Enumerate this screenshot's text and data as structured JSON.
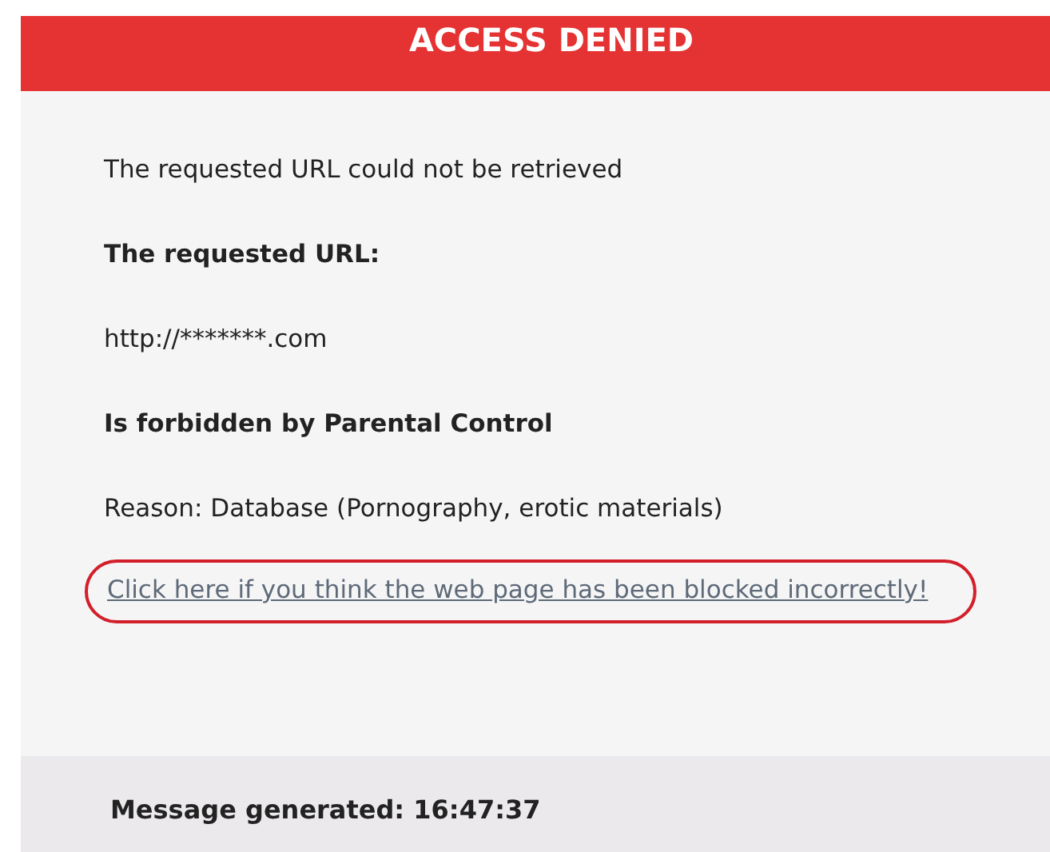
{
  "header": {
    "title": "ACCESS DENIED"
  },
  "message": "The requested URL could not be retrieved",
  "url_label": "The requested URL:",
  "url": "http://*******.com",
  "verdict": "Is forbidden by Parental Control",
  "reason": "Reason: Database (Pornography, erotic materials)",
  "report_link": {
    "text": "Click here if you think the web page has been blocked incorrectly!",
    "highlighted": true
  },
  "footer": {
    "text": "Message generated: 16:47:37"
  }
}
